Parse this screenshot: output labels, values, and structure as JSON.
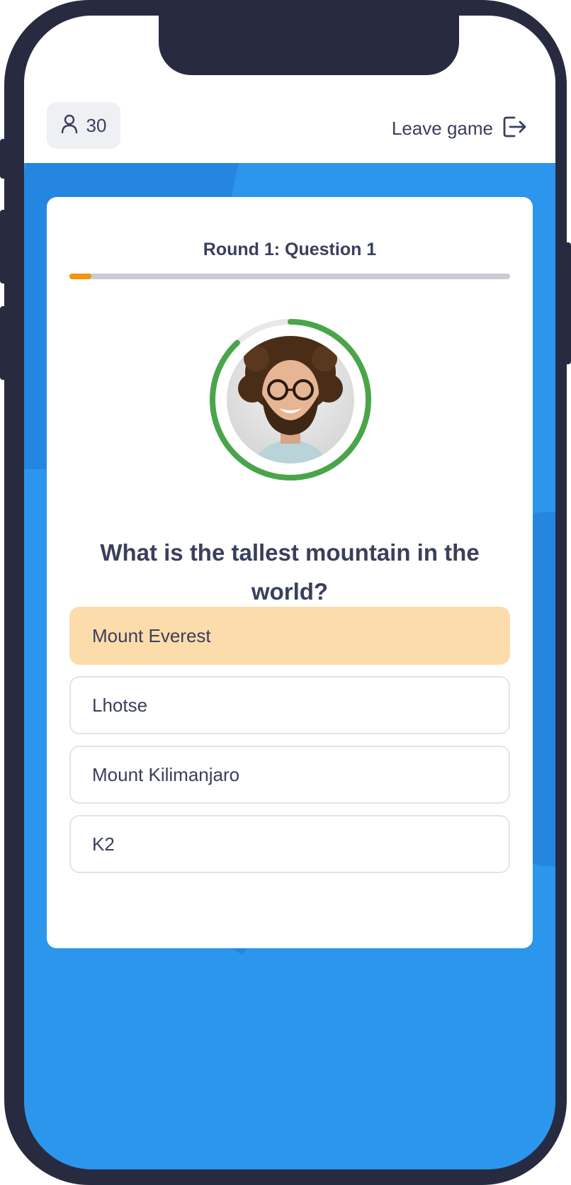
{
  "header": {
    "player_count": "30",
    "leave_label": "Leave game",
    "icons": {
      "players": "user-icon",
      "leave": "exit-icon"
    }
  },
  "quiz": {
    "round_label": "Round 1: Question 1",
    "progress_fraction": 0.05,
    "timer_remaining_fraction": 0.88,
    "question": "What is the tallest mountain in the world?",
    "answers": [
      {
        "label": "Mount Everest",
        "selected": true
      },
      {
        "label": "Lhotse",
        "selected": false
      },
      {
        "label": "Mount Kilimanjaro",
        "selected": false
      },
      {
        "label": "K2",
        "selected": false
      }
    ]
  },
  "colors": {
    "background_blue": "#2c96ec",
    "phone_frame": "#282b40",
    "progress_fill": "#f5940d",
    "progress_track": "#c9cbd8",
    "timer_ring": "#4aa54a",
    "selected_answer": "#fcdcab",
    "text": "#3a3f5c"
  }
}
